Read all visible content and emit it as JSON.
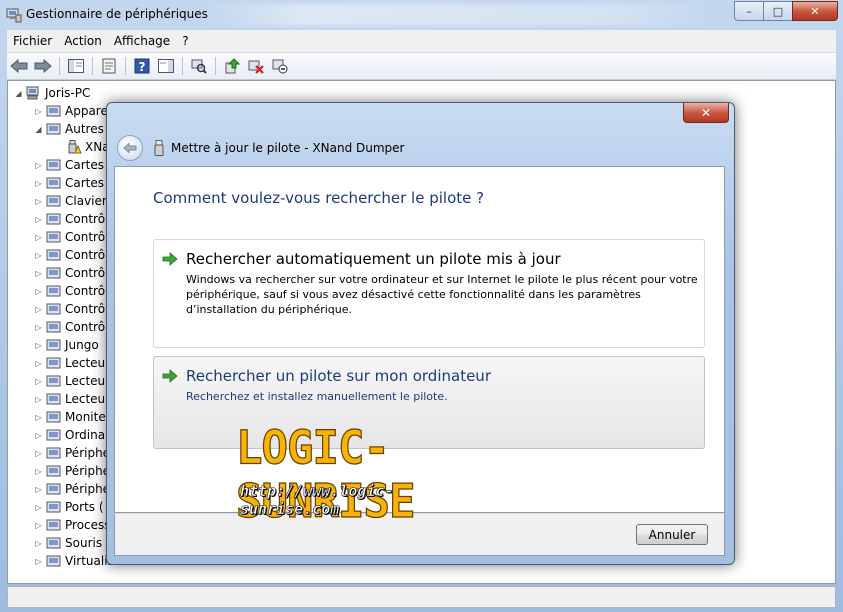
{
  "window": {
    "title": "Gestionnaire de périphériques",
    "minimize_label": "–",
    "maximize_label": "□",
    "close_label": "✕"
  },
  "menu": {
    "items": [
      {
        "label": "Fichier"
      },
      {
        "label": "Action"
      },
      {
        "label": "Affichage"
      },
      {
        "label": "?"
      }
    ]
  },
  "tree": {
    "root": "Joris-PC",
    "items": [
      {
        "label": "Appare",
        "icon": "device-icon"
      },
      {
        "label": "Autres",
        "icon": "unknown-device-icon",
        "expanded": true
      },
      {
        "label": "XNa",
        "icon": "warning-device-icon",
        "child": true
      },
      {
        "label": "Cartes",
        "icon": "display-card-icon"
      },
      {
        "label": "Cartes",
        "icon": "network-card-icon"
      },
      {
        "label": "Clavier",
        "icon": "keyboard-icon"
      },
      {
        "label": "Contrô",
        "icon": "controller-icon"
      },
      {
        "label": "Contrô",
        "icon": "controller-icon"
      },
      {
        "label": "Contrô",
        "icon": "controller-icon"
      },
      {
        "label": "Contrô",
        "icon": "controller-icon"
      },
      {
        "label": "Contrô",
        "icon": "usb-icon"
      },
      {
        "label": "Contrô",
        "icon": "controller-icon"
      },
      {
        "label": "Contrô",
        "icon": "controller-icon"
      },
      {
        "label": "Jungo",
        "icon": "jungo-icon"
      },
      {
        "label": "Lecteur",
        "icon": "drive-icon"
      },
      {
        "label": "Lecteur",
        "icon": "drive-icon"
      },
      {
        "label": "Lecteur",
        "icon": "drive-icon"
      },
      {
        "label": "Monite",
        "icon": "monitor-icon"
      },
      {
        "label": "Ordina",
        "icon": "computer-icon"
      },
      {
        "label": "Périphé",
        "icon": "device-icon"
      },
      {
        "label": "Périphé",
        "icon": "device-icon"
      },
      {
        "label": "Périphé",
        "icon": "device-icon"
      },
      {
        "label": "Ports (",
        "icon": "port-icon"
      },
      {
        "label": "Process",
        "icon": "processor-icon"
      },
      {
        "label": "Souris e",
        "icon": "mouse-icon"
      },
      {
        "label": "Virtualisation USB",
        "icon": "usb-icon"
      }
    ]
  },
  "dialog": {
    "close_label": "✕",
    "header_title": "Mettre à jour le pilote - XNand Dumper",
    "question": "Comment voulez-vous rechercher le pilote ?",
    "option1": {
      "title": "Rechercher automatiquement un pilote mis à jour",
      "description": "Windows va rechercher sur votre ordinateur et sur Internet le pilote le plus récent pour votre périphérique, sauf si vous avez désactivé cette fonctionnalité dans les paramètres d’installation du périphérique."
    },
    "option2": {
      "title": "Rechercher un pilote sur mon ordinateur",
      "description": "Recherchez et installez manuellement le pilote."
    },
    "cancel_label": "Annuler"
  },
  "watermark": {
    "title": "LOGIC-SUNRISE",
    "url": "http://www.logic-sunrise.com"
  },
  "colors": {
    "accent_text": "#1e3a7b",
    "arrow_green": "#2e9a2e",
    "watermark_gold": "#f6b40b"
  }
}
